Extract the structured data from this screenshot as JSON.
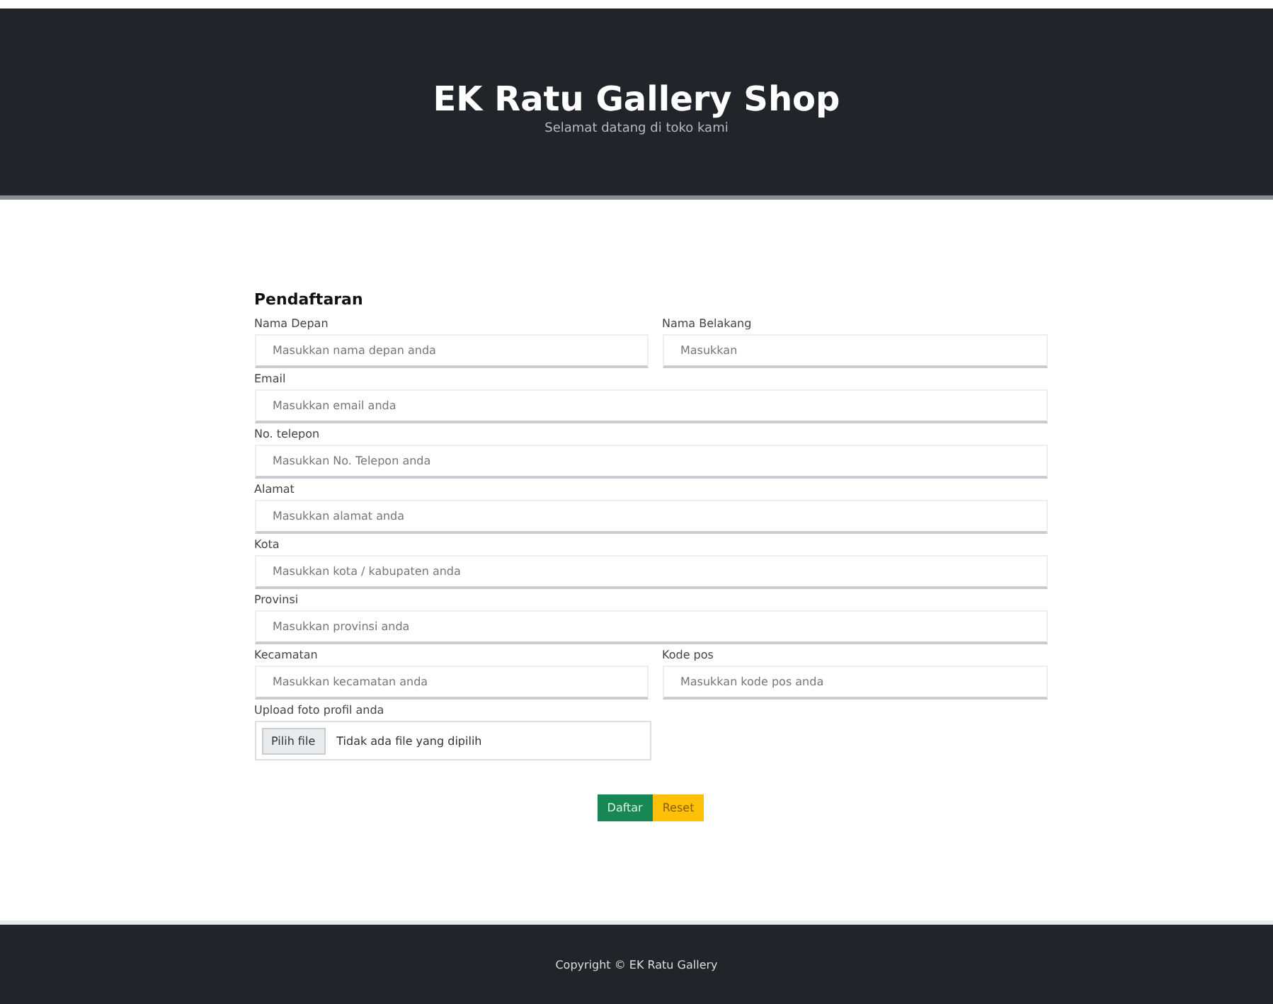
{
  "header": {
    "title": "EK Ratu Gallery Shop",
    "subtitle": "Selamat datang di toko kami"
  },
  "form": {
    "title": "Pendaftaran",
    "rows": [
      {
        "fields": [
          {
            "label": "Nama Depan",
            "placeholder": "Masukkan nama depan anda",
            "kind": "text"
          },
          {
            "label": "Nama Belakang",
            "placeholder": "Masukkan",
            "kind": "text"
          }
        ]
      },
      {
        "fields": [
          {
            "label": "Email",
            "placeholder": "Masukkan email anda",
            "kind": "text"
          }
        ]
      },
      {
        "fields": [
          {
            "label": "No. telepon",
            "placeholder": "Masukkan No. Telepon anda",
            "kind": "text"
          }
        ]
      },
      {
        "fields": [
          {
            "label": "Alamat",
            "placeholder": "Masukkan alamat anda",
            "kind": "text"
          }
        ]
      },
      {
        "fields": [
          {
            "label": "Kota",
            "placeholder": "Masukkan kota / kabupaten anda",
            "kind": "text"
          }
        ]
      },
      {
        "fields": [
          {
            "label": "Provinsi",
            "placeholder": "Masukkan provinsi anda",
            "kind": "text"
          }
        ]
      },
      {
        "fields": [
          {
            "label": "Kecamatan",
            "placeholder": "Masukkan kecamatan anda",
            "kind": "text"
          },
          {
            "label": "Kode pos",
            "placeholder": "Masukkan kode pos anda",
            "kind": "text"
          }
        ]
      },
      {
        "fields": [
          {
            "label": "Upload foto profil anda",
            "button": "Pilih file",
            "placeholder": "Tidak ada file yang dipilih",
            "kind": "file"
          }
        ]
      }
    ],
    "buttons": [
      {
        "label": "Daftar",
        "kind": "primary"
      },
      {
        "label": "Reset",
        "kind": "warning"
      }
    ]
  },
  "footer": {
    "text": "Copyright © EK Ratu Gallery"
  }
}
